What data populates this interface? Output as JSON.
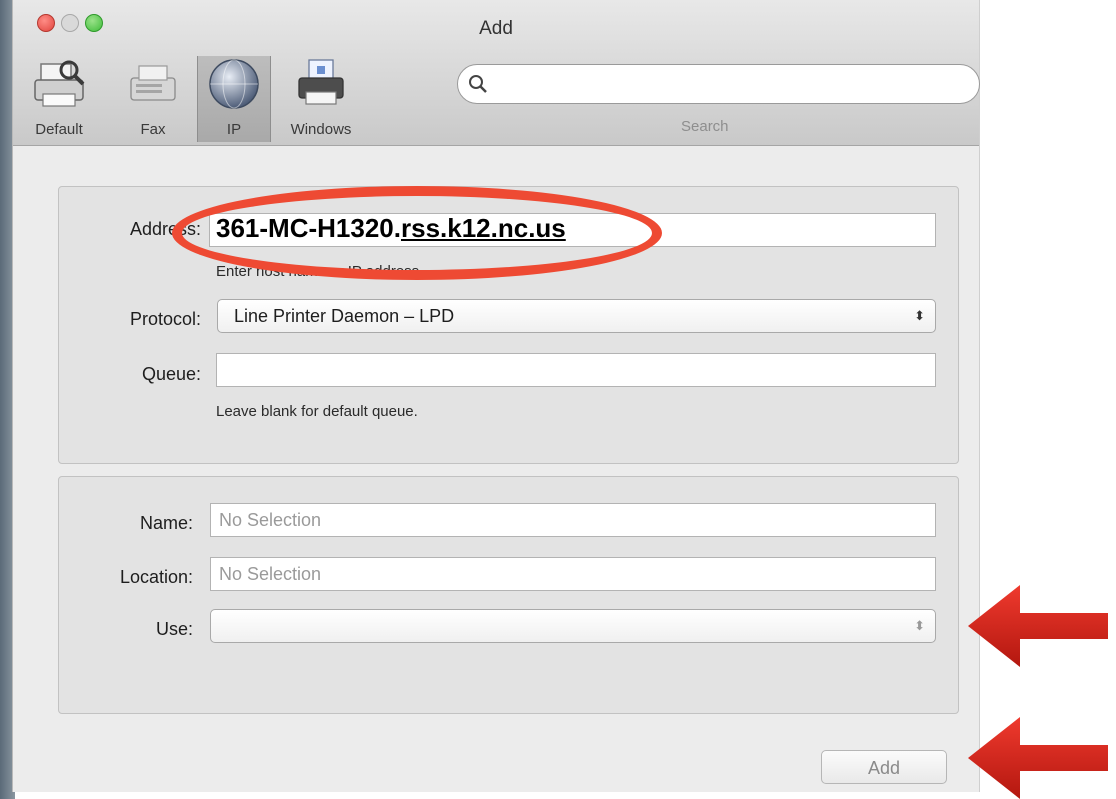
{
  "window": {
    "title": "Add"
  },
  "toolbar": {
    "items": [
      {
        "label": "Default",
        "icon": "default-printer-icon",
        "selected": false
      },
      {
        "label": "Fax",
        "icon": "fax-icon",
        "selected": false
      },
      {
        "label": "IP",
        "icon": "globe-icon",
        "selected": true
      },
      {
        "label": "Windows",
        "icon": "windows-printer-icon",
        "selected": false
      }
    ],
    "search_label": "Search",
    "search_value": ""
  },
  "ip_panel": {
    "address_label": "Address:",
    "address_value": "",
    "address_hint": "Enter host name or IP address.",
    "protocol_label": "Protocol:",
    "protocol_value": "Line Printer Daemon – LPD",
    "queue_label": "Queue:",
    "queue_value": "",
    "queue_hint": "Leave blank for default queue."
  },
  "info_panel": {
    "name_label": "Name:",
    "name_value": "No Selection",
    "location_label": "Location:",
    "location_value": "No Selection",
    "use_label": "Use:",
    "use_value": ""
  },
  "footer": {
    "add_label": "Add"
  },
  "annotation": {
    "address_text_prefix": "361-MC-H1320.",
    "address_text_suffix": "rss.k12.nc.us",
    "highlight_color": "#ee4a33",
    "arrow_color": "#d8261d"
  }
}
